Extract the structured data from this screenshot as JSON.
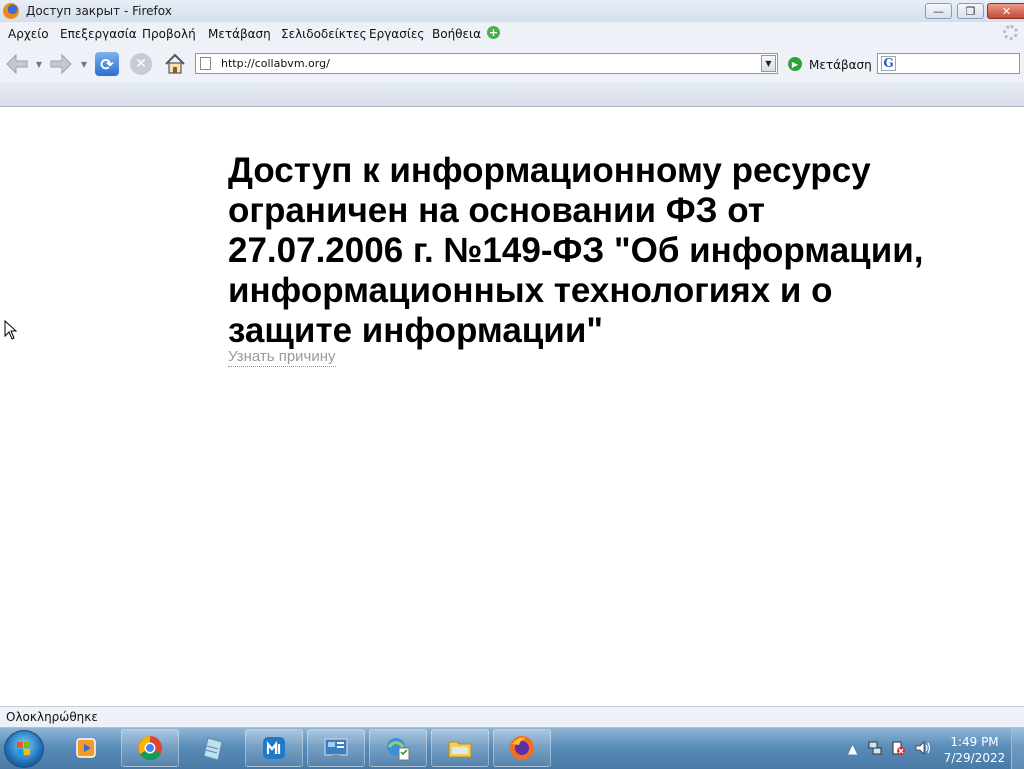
{
  "window": {
    "title": "Доступ закрыт - Firefox",
    "minimize": "—",
    "maximize": "❐",
    "close": "✕"
  },
  "menu": {
    "file": "Αρχείο",
    "edit": "Επεξεργασία",
    "view": "Προβολή",
    "go": "Μετάβαση",
    "bookmarks": "Σελιδοδείκτες",
    "tools": "Εργασίες",
    "help": "Βοήθεια"
  },
  "nav": {
    "url": "http://collabvm.org/",
    "go_label": "Μετάβαση",
    "search_placeholder": ""
  },
  "page": {
    "headline": "Доступ к информационному ресурсу ограничен на основании ФЗ от 27.07.2006 г. №149-ФЗ \"Об информации, информационных технологиях и о защите информации\"",
    "reason_link": "Узнать причину"
  },
  "status": {
    "text": "Ολοκληρώθηκε"
  },
  "taskbar": {
    "apps": [
      "windows-media-player",
      "chrome",
      "notepad",
      "maxthon",
      "control-panel",
      "internet-explorer",
      "file-explorer",
      "firefox"
    ],
    "time": "1:49 PM",
    "date": "7/29/2022"
  },
  "colors": {
    "accent": "#2a6fcf",
    "link": "#999999",
    "taskbar": "#5a8cb8"
  }
}
